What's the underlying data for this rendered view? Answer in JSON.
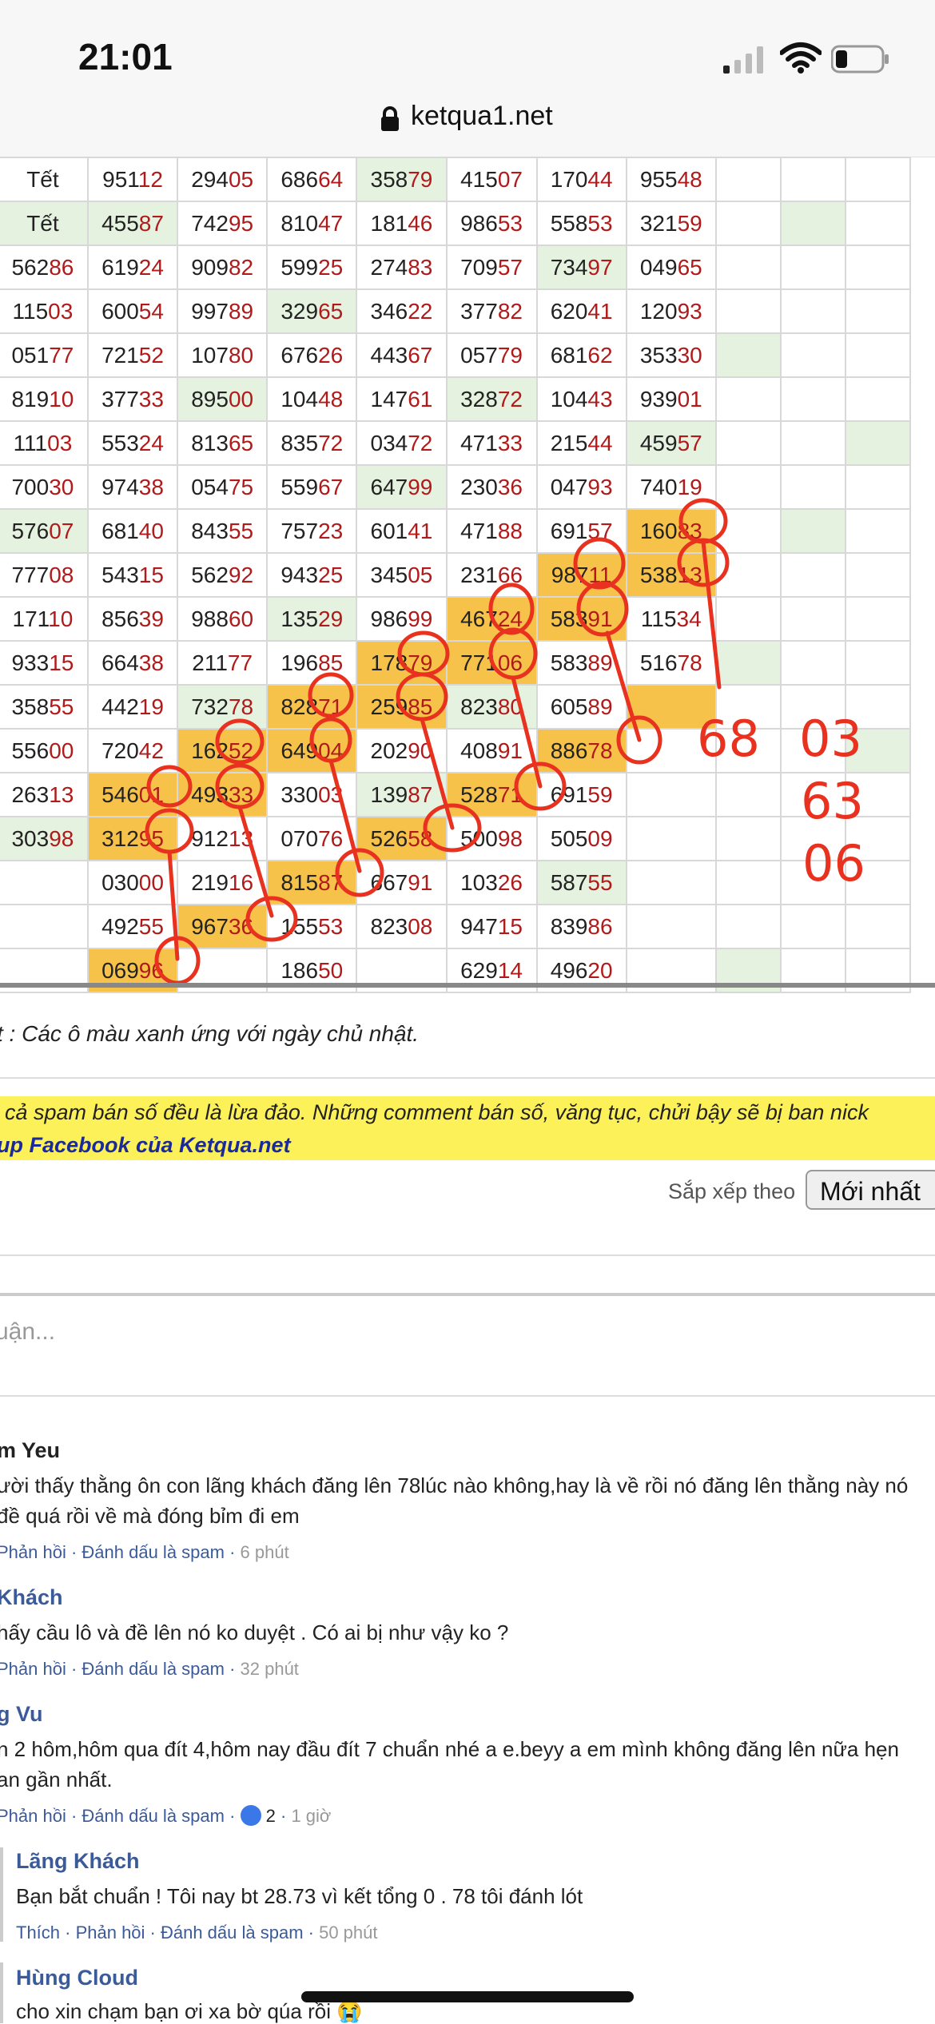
{
  "status_bar": {
    "time": "21:01",
    "icons": [
      "signal-icon",
      "wifi-icon",
      "battery-icon"
    ]
  },
  "browser": {
    "url": "ketqua1.net",
    "lock_icon": "lock-icon"
  },
  "table": {
    "rows": [
      [
        [
          "Tết",
          "w"
        ],
        [
          "95112",
          "w"
        ],
        [
          "29405",
          "w"
        ],
        [
          "68664",
          "w"
        ],
        [
          "35879",
          "g"
        ],
        [
          "41507",
          "w"
        ],
        [
          "17044",
          "w"
        ],
        [
          "95548",
          "w"
        ],
        [
          "",
          "w"
        ],
        [
          "",
          "w"
        ],
        [
          "",
          "w"
        ]
      ],
      [
        [
          "Tết",
          "g"
        ],
        [
          "45587",
          "g"
        ],
        [
          "74295",
          "w"
        ],
        [
          "81047",
          "w"
        ],
        [
          "18146",
          "w"
        ],
        [
          "98653",
          "w"
        ],
        [
          "55853",
          "w"
        ],
        [
          "32159",
          "w"
        ],
        [
          "",
          "w"
        ],
        [
          "",
          "g"
        ],
        [
          "",
          "w"
        ]
      ],
      [
        [
          "56286",
          "w"
        ],
        [
          "61924",
          "w"
        ],
        [
          "90982",
          "w"
        ],
        [
          "59925",
          "w"
        ],
        [
          "27483",
          "w"
        ],
        [
          "70957",
          "w"
        ],
        [
          "73497",
          "g"
        ],
        [
          "04965",
          "w"
        ],
        [
          "",
          "w"
        ],
        [
          "",
          "w"
        ],
        [
          "",
          "w"
        ]
      ],
      [
        [
          "11503",
          "w"
        ],
        [
          "60054",
          "w"
        ],
        [
          "99789",
          "w"
        ],
        [
          "32965",
          "g"
        ],
        [
          "34622",
          "w"
        ],
        [
          "37782",
          "w"
        ],
        [
          "62041",
          "w"
        ],
        [
          "12093",
          "w"
        ],
        [
          "",
          "w"
        ],
        [
          "",
          "w"
        ],
        [
          "",
          "w"
        ]
      ],
      [
        [
          "05177",
          "w"
        ],
        [
          "72152",
          "w"
        ],
        [
          "10780",
          "w"
        ],
        [
          "67626",
          "w"
        ],
        [
          "44367",
          "w"
        ],
        [
          "05779",
          "w"
        ],
        [
          "68162",
          "w"
        ],
        [
          "35330",
          "w"
        ],
        [
          "",
          "g"
        ],
        [
          "",
          "w"
        ],
        [
          "",
          "w"
        ]
      ],
      [
        [
          "81910",
          "w"
        ],
        [
          "37733",
          "w"
        ],
        [
          "89500",
          "g"
        ],
        [
          "10448",
          "w"
        ],
        [
          "14761",
          "w"
        ],
        [
          "32872",
          "g"
        ],
        [
          "10443",
          "w"
        ],
        [
          "93901",
          "w"
        ],
        [
          "",
          "w"
        ],
        [
          "",
          "w"
        ],
        [
          "",
          "w"
        ]
      ],
      [
        [
          "11103",
          "w"
        ],
        [
          "55324",
          "w"
        ],
        [
          "81365",
          "w"
        ],
        [
          "83572",
          "w"
        ],
        [
          "03472",
          "w"
        ],
        [
          "47133",
          "w"
        ],
        [
          "21544",
          "w"
        ],
        [
          "45957",
          "g"
        ],
        [
          "",
          "w"
        ],
        [
          "",
          "w"
        ],
        [
          "",
          "g"
        ]
      ],
      [
        [
          "70030",
          "w"
        ],
        [
          "97438",
          "w"
        ],
        [
          "05475",
          "w"
        ],
        [
          "55967",
          "w"
        ],
        [
          "64799",
          "g"
        ],
        [
          "23036",
          "w"
        ],
        [
          "04793",
          "w"
        ],
        [
          "74019",
          "w"
        ],
        [
          "",
          "w"
        ],
        [
          "",
          "w"
        ],
        [
          "",
          "w"
        ]
      ],
      [
        [
          "57607",
          "g"
        ],
        [
          "68140",
          "w"
        ],
        [
          "84355",
          "w"
        ],
        [
          "75723",
          "w"
        ],
        [
          "60141",
          "w"
        ],
        [
          "47188",
          "w"
        ],
        [
          "69157",
          "w"
        ],
        [
          "16083",
          "y"
        ],
        [
          "",
          "w"
        ],
        [
          "",
          "g"
        ],
        [
          "",
          "w"
        ]
      ],
      [
        [
          "77708",
          "w"
        ],
        [
          "54315",
          "w"
        ],
        [
          "56292",
          "w"
        ],
        [
          "94325",
          "w"
        ],
        [
          "34505",
          "w"
        ],
        [
          "23166",
          "w"
        ],
        [
          "98711",
          "y"
        ],
        [
          "53813",
          "y"
        ],
        [
          "",
          "w"
        ],
        [
          "",
          "w"
        ],
        [
          "",
          "w"
        ]
      ],
      [
        [
          "17110",
          "w"
        ],
        [
          "85639",
          "w"
        ],
        [
          "98860",
          "w"
        ],
        [
          "13529",
          "g"
        ],
        [
          "98699",
          "w"
        ],
        [
          "46724",
          "y"
        ],
        [
          "58391",
          "y"
        ],
        [
          "11534",
          "w"
        ],
        [
          "",
          "w"
        ],
        [
          "",
          "w"
        ],
        [
          "",
          "w"
        ]
      ],
      [
        [
          "93315",
          "w"
        ],
        [
          "66438",
          "w"
        ],
        [
          "21177",
          "w"
        ],
        [
          "19685",
          "w"
        ],
        [
          "17879",
          "y"
        ],
        [
          "77106",
          "y"
        ],
        [
          "58389",
          "w"
        ],
        [
          "51678",
          "w"
        ],
        [
          "",
          "g"
        ],
        [
          "",
          "w"
        ],
        [
          "",
          "w"
        ]
      ],
      [
        [
          "35855",
          "w"
        ],
        [
          "44219",
          "w"
        ],
        [
          "73278",
          "g"
        ],
        [
          "82871",
          "y"
        ],
        [
          "25985",
          "y"
        ],
        [
          "82380",
          "g"
        ],
        [
          "60589",
          "w"
        ],
        [
          "",
          "y"
        ],
        [
          "",
          "w"
        ],
        [
          "",
          "w"
        ],
        [
          "",
          "w"
        ]
      ],
      [
        [
          "55600",
          "w"
        ],
        [
          "72042",
          "w"
        ],
        [
          "16252",
          "y"
        ],
        [
          "64904",
          "y"
        ],
        [
          "20290",
          "w"
        ],
        [
          "40891",
          "w"
        ],
        [
          "88678",
          "y"
        ],
        [
          "",
          "w"
        ],
        [
          "",
          "w"
        ],
        [
          "",
          "w"
        ],
        [
          "",
          "g"
        ]
      ],
      [
        [
          "26313",
          "w"
        ],
        [
          "54601",
          "y"
        ],
        [
          "49333",
          "y"
        ],
        [
          "33003",
          "w"
        ],
        [
          "13987",
          "g"
        ],
        [
          "52871",
          "y"
        ],
        [
          "69159",
          "w"
        ],
        [
          "",
          "w"
        ],
        [
          "",
          "w"
        ],
        [
          "",
          "w"
        ],
        [
          "",
          "w"
        ]
      ],
      [
        [
          "30398",
          "g"
        ],
        [
          "31295",
          "y"
        ],
        [
          "91213",
          "w"
        ],
        [
          "07076",
          "w"
        ],
        [
          "52658",
          "y"
        ],
        [
          "50098",
          "w"
        ],
        [
          "50509",
          "w"
        ],
        [
          "",
          "w"
        ],
        [
          "",
          "w"
        ],
        [
          "",
          "w"
        ],
        [
          "",
          "w"
        ]
      ],
      [
        [
          "",
          "w"
        ],
        [
          "03000",
          "w"
        ],
        [
          "21916",
          "w"
        ],
        [
          "81587",
          "y"
        ],
        [
          "66791",
          "w"
        ],
        [
          "10326",
          "w"
        ],
        [
          "58755",
          "g"
        ],
        [
          "",
          "w"
        ],
        [
          "",
          "w"
        ],
        [
          "",
          "w"
        ],
        [
          "",
          "w"
        ]
      ],
      [
        [
          "",
          "w"
        ],
        [
          "49255",
          "w"
        ],
        [
          "96736",
          "y"
        ],
        [
          "15553",
          "w"
        ],
        [
          "82308",
          "w"
        ],
        [
          "94715",
          "w"
        ],
        [
          "83986",
          "w"
        ],
        [
          "",
          "w"
        ],
        [
          "",
          "w"
        ],
        [
          "",
          "w"
        ],
        [
          "",
          "w"
        ]
      ],
      [
        [
          "",
          "w"
        ],
        [
          "06996",
          "y"
        ],
        [
          "",
          "w"
        ],
        [
          "18650",
          "w"
        ],
        [
          "",
          "w"
        ],
        [
          "62914",
          "w"
        ],
        [
          "49620",
          "w"
        ],
        [
          "",
          "w"
        ],
        [
          "",
          "g"
        ],
        [
          "",
          "w"
        ],
        [
          "",
          "w"
        ]
      ]
    ]
  },
  "annotations": {
    "left": "68",
    "right": [
      "03",
      "63",
      "06"
    ]
  },
  "note": "t : Các ô màu xanh ứng với ngày chủ nhật.",
  "warning": {
    "line1": "cả spam bán số đều là lừa đảo. Những comment bán số, văng tục, chửi bậy sẽ bị ban nick",
    "line2": "up Facebook của Ketqua.net"
  },
  "sort": {
    "label": "Sắp xếp theo",
    "value": "Mới nhất"
  },
  "comment_placeholder": "uận...",
  "comments": [
    {
      "name": "m Yeu",
      "lines": [
        "ười thấy thằng ôn con lãng khách đăng lên 78lúc nào không,hay là về rồi nó đăng lên thằng này nó",
        " đề quá rồi về mà đóng bỉm đi em"
      ],
      "actions": "Phản hồi · Đánh dấu là spam · ",
      "time": "6 phút"
    },
    {
      "name": "Khách",
      "lines": [
        "hấy cầu lô và đề lên nó ko duyệt . Có ai bị như vậy ko ?"
      ],
      "actions": "Phản hồi · Đánh dấu là spam · ",
      "time": "32 phút"
    },
    {
      "name": "g Vu",
      "lines": [
        "n 2 hôm,hôm qua đít 4,hôm nay đầu đít 7 chuẩn nhé a e.beyy a em mình không đăng lên nữa hẹn",
        "an gần nhất."
      ],
      "actions": "Phản hồi · Đánh dấu là spam · ",
      "likes": "2",
      "time": "1 giờ"
    }
  ],
  "replies": [
    {
      "name": "Lãng Khách",
      "text": "Bạn bắt chuẩn ! Tôi nay bt 28.73 vì kết tổng 0 . 78 tôi đánh lót",
      "actions": "Thích · Phản hồi · Đánh dấu là spam · ",
      "time": "50 phút"
    },
    {
      "name": "Hùng Cloud",
      "text": "cho xin chạm bạn ơi xa bờ qúa rồi 😭"
    }
  ]
}
